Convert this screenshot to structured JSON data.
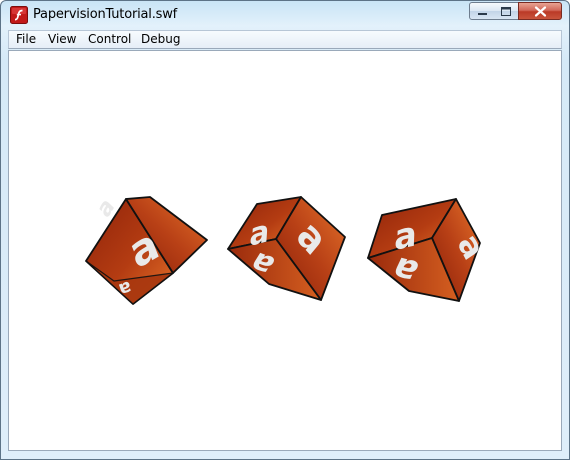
{
  "window": {
    "title": "PapervisionTutorial.swf",
    "app_icon": "flash-player-icon",
    "controls": {
      "minimize": "minimize-icon",
      "maximize": "maximize-icon",
      "close": "close-icon"
    }
  },
  "menu": {
    "file": "File",
    "view": "View",
    "control": "Control",
    "debug": "Debug"
  },
  "stage": {
    "face_letter": "a",
    "cube_count": 3
  },
  "colors": {
    "cube_face_dark": "#8f230a",
    "cube_face_light": "#e5722a",
    "cube_edge": "#111111",
    "letter_fill": "#e9e9e9",
    "close_button": "#c9543c"
  }
}
